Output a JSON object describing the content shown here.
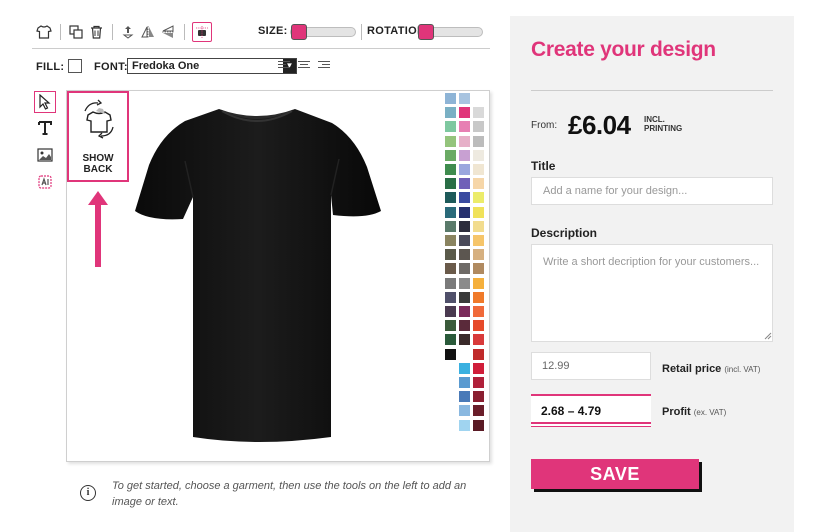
{
  "toolbar": {
    "size_label": "SIZE:",
    "rotation_label": "ROTATION:",
    "size_value": 0,
    "rotation_value": 0,
    "icons": [
      "garment-icon",
      "duplicate-icon",
      "delete-icon",
      "bring-forward-icon",
      "flip-horizontal-icon",
      "flip-vertical-icon",
      "center-icon"
    ]
  },
  "format_bar": {
    "fill_label": "FILL:",
    "fill_color": "#ffffff",
    "font_label": "FONT:",
    "font_value": "Fredoka One",
    "align_icons": [
      "align-left-icon",
      "align-center-icon",
      "align-right-icon"
    ]
  },
  "left_tools": [
    "select-pointer-icon",
    "text-tool-icon",
    "image-tool-icon",
    "ai-tool-icon"
  ],
  "canvas": {
    "show_back_label": "SHOW\nBACK",
    "garment_color": "#111111"
  },
  "palette": {
    "colors": [
      "#8eb4d6",
      "#a8c4e0",
      "#ffffff",
      "#7ab0c4",
      "#e0357a",
      "#d9d9d9",
      "#7ec8a0",
      "#e77fb3",
      "#c8c8c8",
      "#94c47c",
      "#e6b0c8",
      "#bcbcbc",
      "#6aaa64",
      "#c8a0d2",
      "#eeeae0",
      "#3f8c4e",
      "#9aa6de",
      "#f0e6d2",
      "#2a6e46",
      "#7060b8",
      "#f6d6a8",
      "#1e5a5a",
      "#3a4aa0",
      "#ecec6a",
      "#2a6a7a",
      "#26306e",
      "#f0e25a",
      "#5a7a6a",
      "#2c2c3c",
      "#f2dc8e",
      "#8a8460",
      "#4a4a5a",
      "#f6c56a",
      "#5a5a4a",
      "#5c5650",
      "#d6b080",
      "#6a5a4a",
      "#6e6a66",
      "#b08a60",
      "#7a7a7a",
      "#8a8a8a",
      "#f5b03c",
      "#50506a",
      "#3a3a3a",
      "#f07a2a",
      "#4a3a50",
      "#7a2a5a",
      "#f06a3a",
      "#3a5a3a",
      "#5a2a3a",
      "#e64a2a",
      "#2a5a3a",
      "#3a2a2a",
      "#d83a3a",
      "#111111",
      "#ffffff",
      "#c02a2a",
      "#ffffff",
      "#3ab0e0",
      "#d01e3a",
      "#ffffff",
      "#5a9ad0",
      "#b0203a",
      "#ffffff",
      "#4a7ab8",
      "#8a1e30",
      "#ffffff",
      "#8ab8e0",
      "#6a1e2a",
      "#ffffff",
      "#a0d4f0",
      "#5a1a24"
    ]
  },
  "hint": {
    "text": "To get started, choose a garment, then use the tools on the left to add an image or text."
  },
  "panel": {
    "title": "Create your design",
    "from_label": "From:",
    "price": "£6.04",
    "price_note": "INCL. PRINTING",
    "title_label": "Title",
    "title_placeholder": "Add a name for your design...",
    "description_label": "Description",
    "description_placeholder": "Write a short decription for your customers...",
    "retail_value": "12.99",
    "retail_label": "Retail price",
    "retail_note": "(incl. VAT)",
    "profit_value": "2.68 – 4.79",
    "profit_label": "Profit",
    "profit_note": "(ex. VAT)",
    "save_label": "SAVE",
    "accent_color": "#e0357a"
  }
}
